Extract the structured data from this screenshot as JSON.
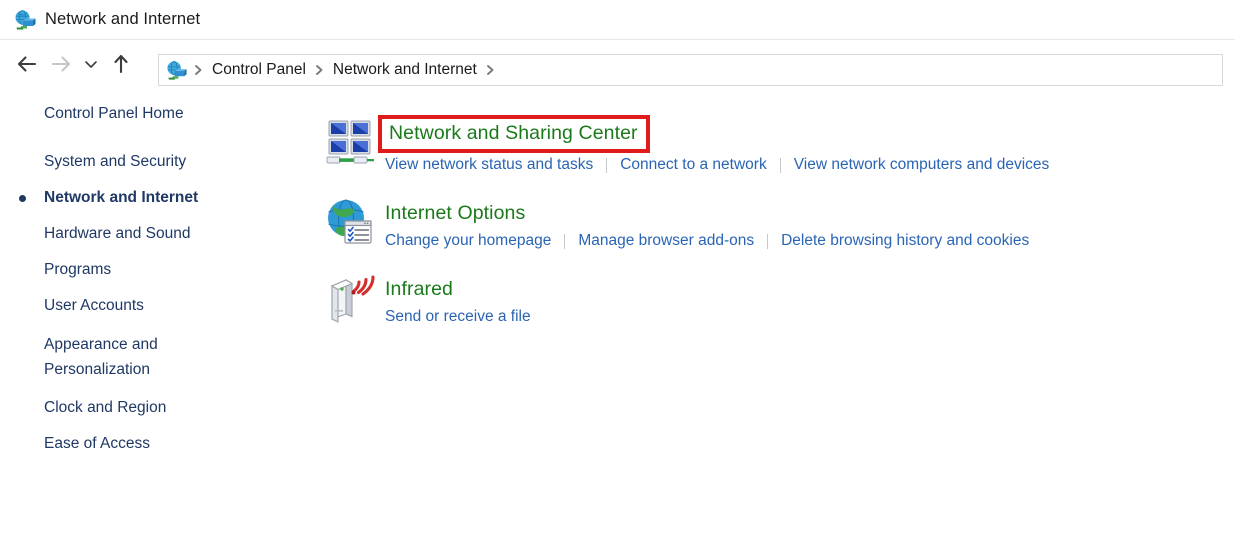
{
  "window": {
    "title": "Network and Internet",
    "title_icon": "network-internet-icon"
  },
  "toolbar": {
    "back_label": "Back",
    "forward_label": "Forward",
    "recent_label": "Recent locations",
    "up_label": "Up one level",
    "icons": {
      "back": "back-arrow-icon",
      "forward": "forward-arrow-icon",
      "recent": "chevron-down-icon",
      "up": "up-arrow-icon"
    }
  },
  "address_bar": {
    "icon": "network-internet-icon",
    "crumbs": [
      {
        "label": "Control Panel"
      },
      {
        "label": "Network and Internet"
      }
    ],
    "trailing_chevron": ">"
  },
  "sidebar": {
    "home_label": "Control Panel Home",
    "items": [
      {
        "label": "System and Security",
        "selected": false
      },
      {
        "label": "Network and Internet",
        "selected": true
      },
      {
        "label": "Hardware and Sound",
        "selected": false
      },
      {
        "label": "Programs",
        "selected": false
      },
      {
        "label": "User Accounts",
        "selected": false
      },
      {
        "label": "Appearance and Personalization",
        "selected": false
      },
      {
        "label": "Clock and Region",
        "selected": false
      },
      {
        "label": "Ease of Access",
        "selected": false
      }
    ]
  },
  "categories": [
    {
      "title": "Network and Sharing Center",
      "icon": "network-sharing-center-icon",
      "highlighted": true,
      "links": [
        "View network status and tasks",
        "Connect to a network",
        "View network computers and devices"
      ]
    },
    {
      "title": "Internet Options",
      "icon": "internet-options-icon",
      "highlighted": false,
      "links": [
        "Change your homepage",
        "Manage browser add-ons",
        "Delete browsing history and cookies"
      ]
    },
    {
      "title": "Infrared",
      "icon": "infrared-icon",
      "highlighted": false,
      "links": [
        "Send or receive a file"
      ]
    }
  ],
  "colors": {
    "category_title": "#1a7a1a",
    "link": "#2a64b4",
    "sidebar_text": "#1f3864",
    "highlight_box": "#e01b1b"
  }
}
